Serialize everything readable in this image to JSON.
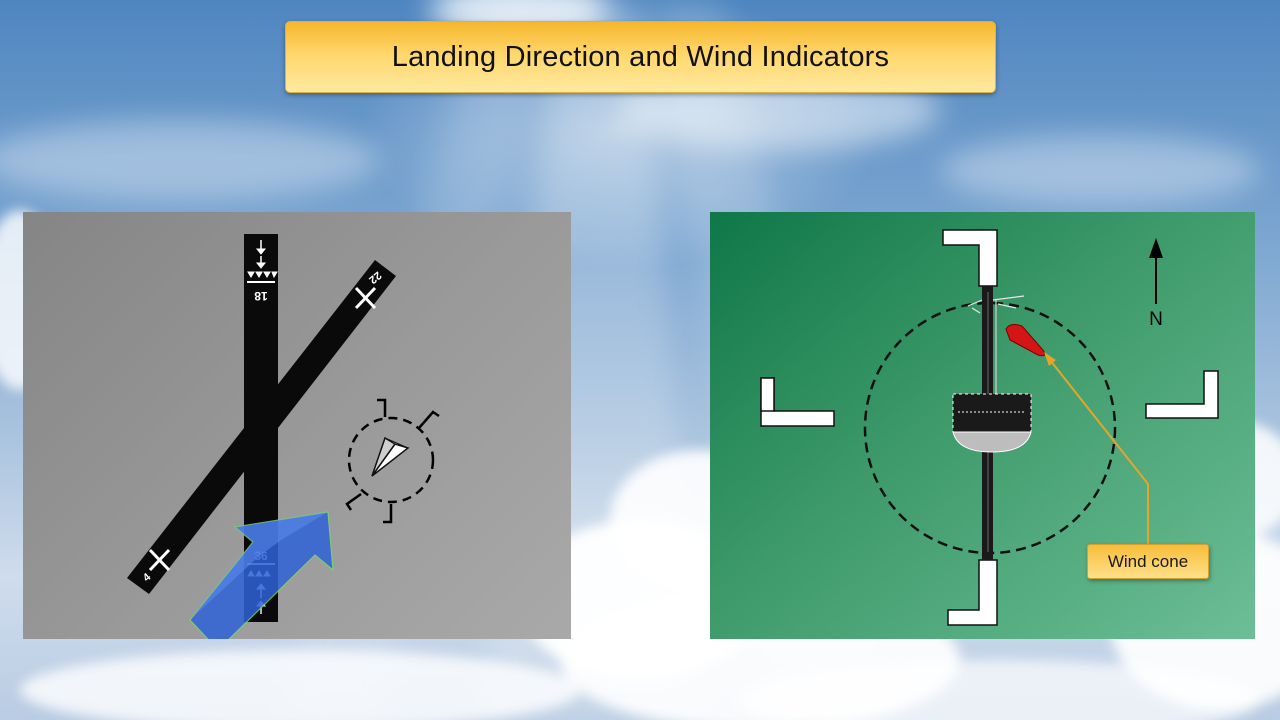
{
  "slide": {
    "title": "Landing Direction and Wind Indicators"
  },
  "runway_diagram": {
    "runway_number_top": "18",
    "runway_number_bottom": "36",
    "diagonal_number_top": "22",
    "diagonal_number_bottom": "4"
  },
  "wind_diagram": {
    "north_label": "N",
    "callout_label": "Wind cone"
  },
  "colors": {
    "title_gold": "#ffd66b",
    "runway_black": "#0a0a0a",
    "arrow_blue": "#2f63d8",
    "wind_cone_red": "#d41515",
    "green_panel": "#3e9a6a"
  }
}
